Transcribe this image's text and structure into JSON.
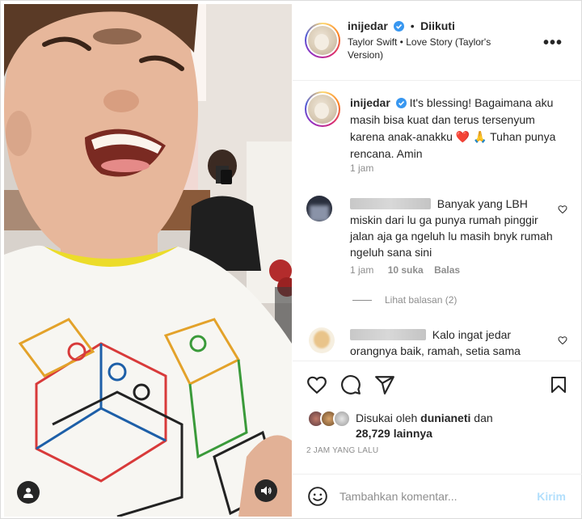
{
  "post": {
    "username": "inijedar",
    "follow_separator": "•",
    "follow_status": "Diikuti",
    "audio": "Taylor Swift • Love Story (Taylor's Version)",
    "more_icon": "•••"
  },
  "caption": {
    "username": "inijedar",
    "text": "It's blessing! Bagaimana aku masih bisa kuat dan terus tersenyum karena anak-anakku ❤️ 🙏 Tuhan punya rencana. Amin",
    "time": "1 jam"
  },
  "comments": [
    {
      "text": "Banyak yang LBH miskin dari lu ga punya rumah pinggir jalan aja ga ngeluh lu masih bnyk rumah ngeluh sana sini",
      "time": "1 jam",
      "likes": "10 suka",
      "reply": "Balas",
      "view_replies": "Lihat balasan (2)"
    },
    {
      "text": "Kalo ingat jedar orangnya baik, ramah, setia sama"
    }
  ],
  "liked_by": {
    "prefix": "Disukai oleh",
    "user": "dunianeti",
    "conj": "dan",
    "count": "28,729 lainnya"
  },
  "timestamp": "2 JAM YANG LALU",
  "composer": {
    "placeholder": "Tambahkan komentar...",
    "post_label": "Kirim"
  },
  "colors": {
    "verified": "#3897f0",
    "like_red": "#ed4956",
    "post_disabled": "#b2dffc",
    "muted": "#8e8e8e"
  }
}
